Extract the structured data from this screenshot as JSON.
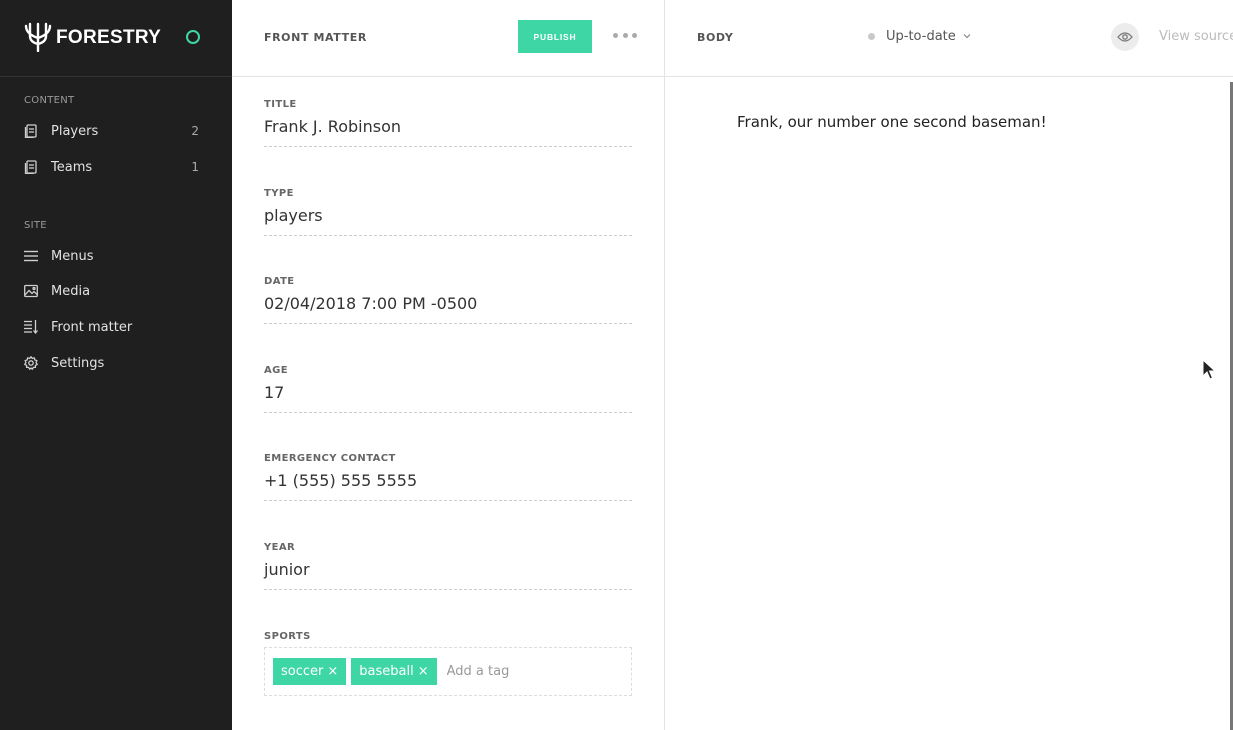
{
  "brand": {
    "name": "FORESTRY"
  },
  "sidebar": {
    "sections": [
      {
        "label": "CONTENT",
        "items": [
          {
            "label": "Players",
            "count": "2",
            "icon": "document-icon"
          },
          {
            "label": "Teams",
            "count": "1",
            "icon": "document-icon"
          }
        ]
      },
      {
        "label": "SITE",
        "items": [
          {
            "label": "Menus",
            "icon": "menu-icon"
          },
          {
            "label": "Media",
            "icon": "image-icon"
          },
          {
            "label": "Front matter",
            "icon": "sliders-icon"
          },
          {
            "label": "Settings",
            "icon": "gear-icon"
          }
        ]
      }
    ]
  },
  "front_matter": {
    "header": {
      "title": "FRONT MATTER",
      "publish_label": "PUBLISH"
    },
    "fields": [
      {
        "label": "TITLE",
        "value": "Frank J. Robinson"
      },
      {
        "label": "TYPE",
        "value": "players"
      },
      {
        "label": "DATE",
        "value": "02/04/2018 7:00 PM -0500"
      },
      {
        "label": "AGE",
        "value": "17"
      },
      {
        "label": "EMERGENCY CONTACT",
        "value": "+1 (555) 555 5555"
      },
      {
        "label": "YEAR",
        "value": "junior"
      }
    ],
    "sports": {
      "label": "SPORTS",
      "tags": [
        "soccer",
        "baseball"
      ],
      "remove_glyph": "×",
      "placeholder": "Add a tag"
    }
  },
  "body": {
    "header": {
      "title": "BODY",
      "status": "Up-to-date",
      "view_source": "View source"
    },
    "content": "Frank, our number one second baseman!"
  },
  "colors": {
    "accent": "#3fd6a6",
    "sidebar_bg": "#1f1f1f"
  }
}
